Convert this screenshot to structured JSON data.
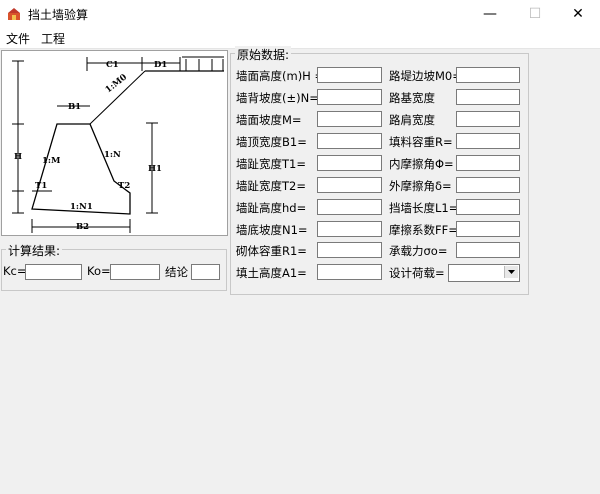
{
  "window": {
    "title": "挡土墙验算",
    "minimize": "—",
    "maximize": "☐",
    "close": "✕"
  },
  "menu": {
    "file": "文件",
    "project": "工程"
  },
  "diagram": {
    "labels": [
      "C1",
      "D1",
      "1:M0",
      "B1",
      "1:M",
      "1:N",
      "T1",
      "T2",
      "1:N1",
      "B2",
      "H",
      "H1"
    ]
  },
  "params": {
    "title": "原始数据:",
    "left": [
      {
        "label": "墙面高度(m)H =",
        "value": ""
      },
      {
        "label": "墙背坡度(±)N=",
        "value": ""
      },
      {
        "label": "墙面坡度M=",
        "value": ""
      },
      {
        "label": "墙顶宽度B1=",
        "value": ""
      },
      {
        "label": "墙趾宽度T1=",
        "value": ""
      },
      {
        "label": "墙趾宽度T2=",
        "value": ""
      },
      {
        "label": "墙趾高度hd=",
        "value": ""
      },
      {
        "label": "墙底坡度N1=",
        "value": ""
      },
      {
        "label": "砌体容重R1=",
        "value": ""
      },
      {
        "label": "填土高度A1=",
        "value": ""
      }
    ],
    "right": [
      {
        "label": "路堤边坡M0=",
        "value": ""
      },
      {
        "label": "路基宽度",
        "value": ""
      },
      {
        "label": "路肩宽度",
        "value": ""
      },
      {
        "label": "填料容重R=",
        "value": ""
      },
      {
        "label": "内摩擦角Φ=",
        "value": ""
      },
      {
        "label": "外摩擦角δ=",
        "value": ""
      },
      {
        "label": "挡墙长度L1=",
        "value": ""
      },
      {
        "label": "摩擦系数FF=",
        "value": ""
      },
      {
        "label": "承载力σo=",
        "value": ""
      },
      {
        "label": "设计荷载=",
        "value": ""
      }
    ]
  },
  "results": {
    "title": "计算结果:",
    "kc_label": "Kc=",
    "kc_value": "",
    "ko_label": "Ko=",
    "ko_value": "",
    "conclusion_label": "结论",
    "conclusion_value": ""
  }
}
